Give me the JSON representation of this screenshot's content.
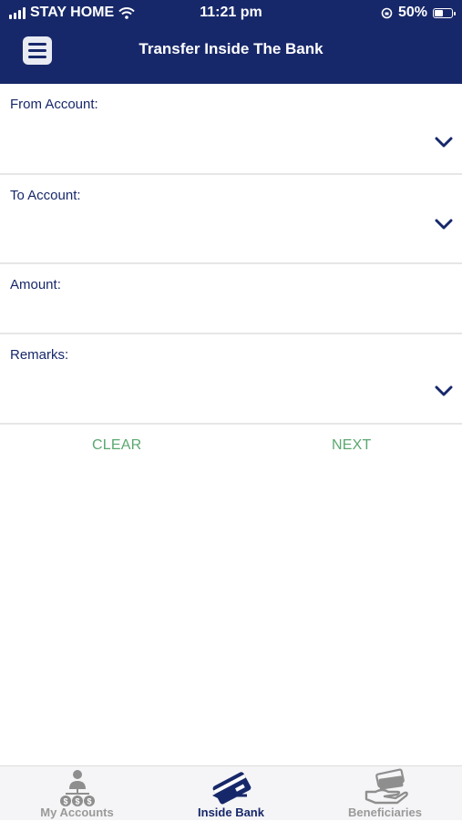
{
  "status_bar": {
    "carrier": "STAY HOME",
    "time": "11:21 pm",
    "battery": "50%"
  },
  "header": {
    "title": "Transfer Inside The Bank",
    "menu_icon": "hamburger-menu-icon"
  },
  "form": {
    "from_account": {
      "label": "From Account:",
      "value": ""
    },
    "to_account": {
      "label": "To Account:",
      "value": ""
    },
    "amount": {
      "label": "Amount:",
      "value": ""
    },
    "remarks": {
      "label": "Remarks:",
      "value": ""
    }
  },
  "actions": {
    "clear_label": "CLEAR",
    "next_label": "NEXT"
  },
  "tabbar": {
    "tabs": [
      {
        "label": "My Accounts",
        "icon": "accounts-user-coins-icon",
        "active": false
      },
      {
        "label": "Inside Bank",
        "icon": "card-transfer-icon",
        "active": true
      },
      {
        "label": "Beneficiaries",
        "icon": "hand-cash-icon",
        "active": false
      }
    ]
  },
  "colors": {
    "primary": "#17286a",
    "action_green": "#5aa86f",
    "tab_inactive": "#9a9a9a",
    "divider": "#e6e6e6"
  }
}
